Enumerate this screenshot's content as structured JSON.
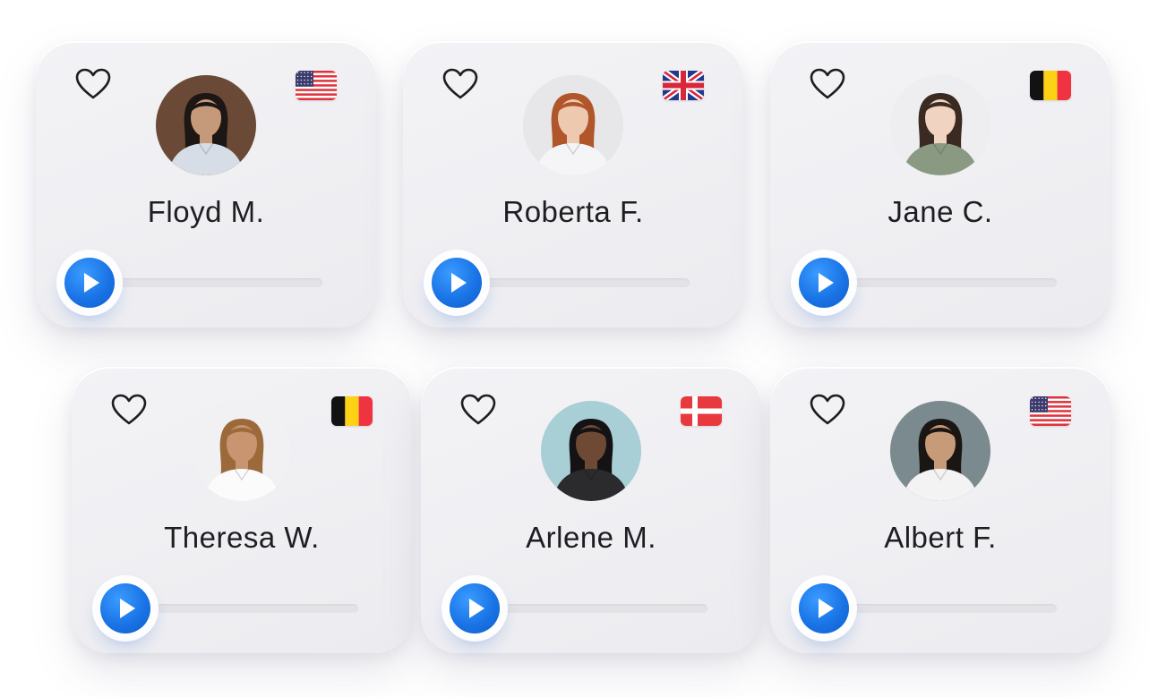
{
  "cards": [
    {
      "name": "Floyd M.",
      "flag": "united-states",
      "favorited": false,
      "progress": 0,
      "avatar_bg": "#6a4a36",
      "skin": "#c59a7a",
      "hair": "#1c1614",
      "shirt": "#d7dde6"
    },
    {
      "name": "Roberta F.",
      "flag": "united-kingdom",
      "favorited": false,
      "progress": 0,
      "avatar_bg": "#e7e7ea",
      "skin": "#edc9b0",
      "hair": "#b0562a",
      "shirt": "#f5f5f7"
    },
    {
      "name": "Jane C.",
      "flag": "belgium",
      "favorited": false,
      "progress": 0,
      "avatar_bg": "#eeeef0",
      "skin": "#f0d3c0",
      "hair": "#3a2a22",
      "shirt": "#8a9a82"
    },
    {
      "name": "Theresa W.",
      "flag": "belgium",
      "favorited": false,
      "progress": 0,
      "avatar_bg": "#f1f1f3",
      "skin": "#c99570",
      "hair": "#9c6a3a",
      "shirt": "#fbfbfb"
    },
    {
      "name": "Arlene M.",
      "flag": "denmark",
      "favorited": false,
      "progress": 0,
      "avatar_bg": "#a9cfd6",
      "skin": "#6e4a34",
      "hair": "#141214",
      "shirt": "#2b2b2e"
    },
    {
      "name": "Albert F.",
      "flag": "united-states",
      "favorited": false,
      "progress": 0,
      "avatar_bg": "#7b8a8e",
      "skin": "#c89b78",
      "hair": "#1a1614",
      "shirt": "#f3f3f3"
    }
  ],
  "colors": {
    "accent": "#1a74e6",
    "heart_outline": "#1e1e22",
    "track": "#e2e2e7"
  }
}
